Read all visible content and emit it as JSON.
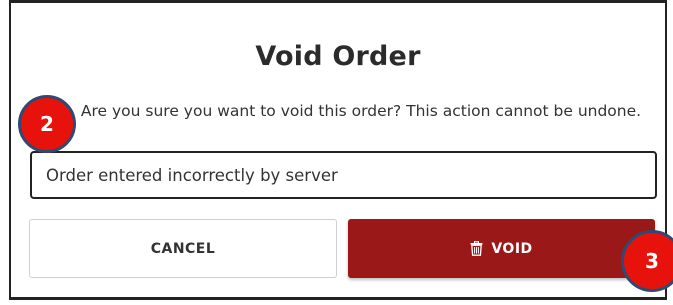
{
  "dialog": {
    "title": "Void Order",
    "message": "Are you sure you want to void this order? This action cannot be undone.",
    "reason_value": "Order entered incorrectly by server",
    "cancel_label": "CANCEL",
    "void_label": "VOID",
    "void_icon": "trash-icon"
  },
  "annotations": {
    "step_2": "2",
    "step_3": "3"
  },
  "colors": {
    "void_button": "#9b1818",
    "badge_fill": "#e8120c",
    "badge_border": "#2f4a72"
  }
}
